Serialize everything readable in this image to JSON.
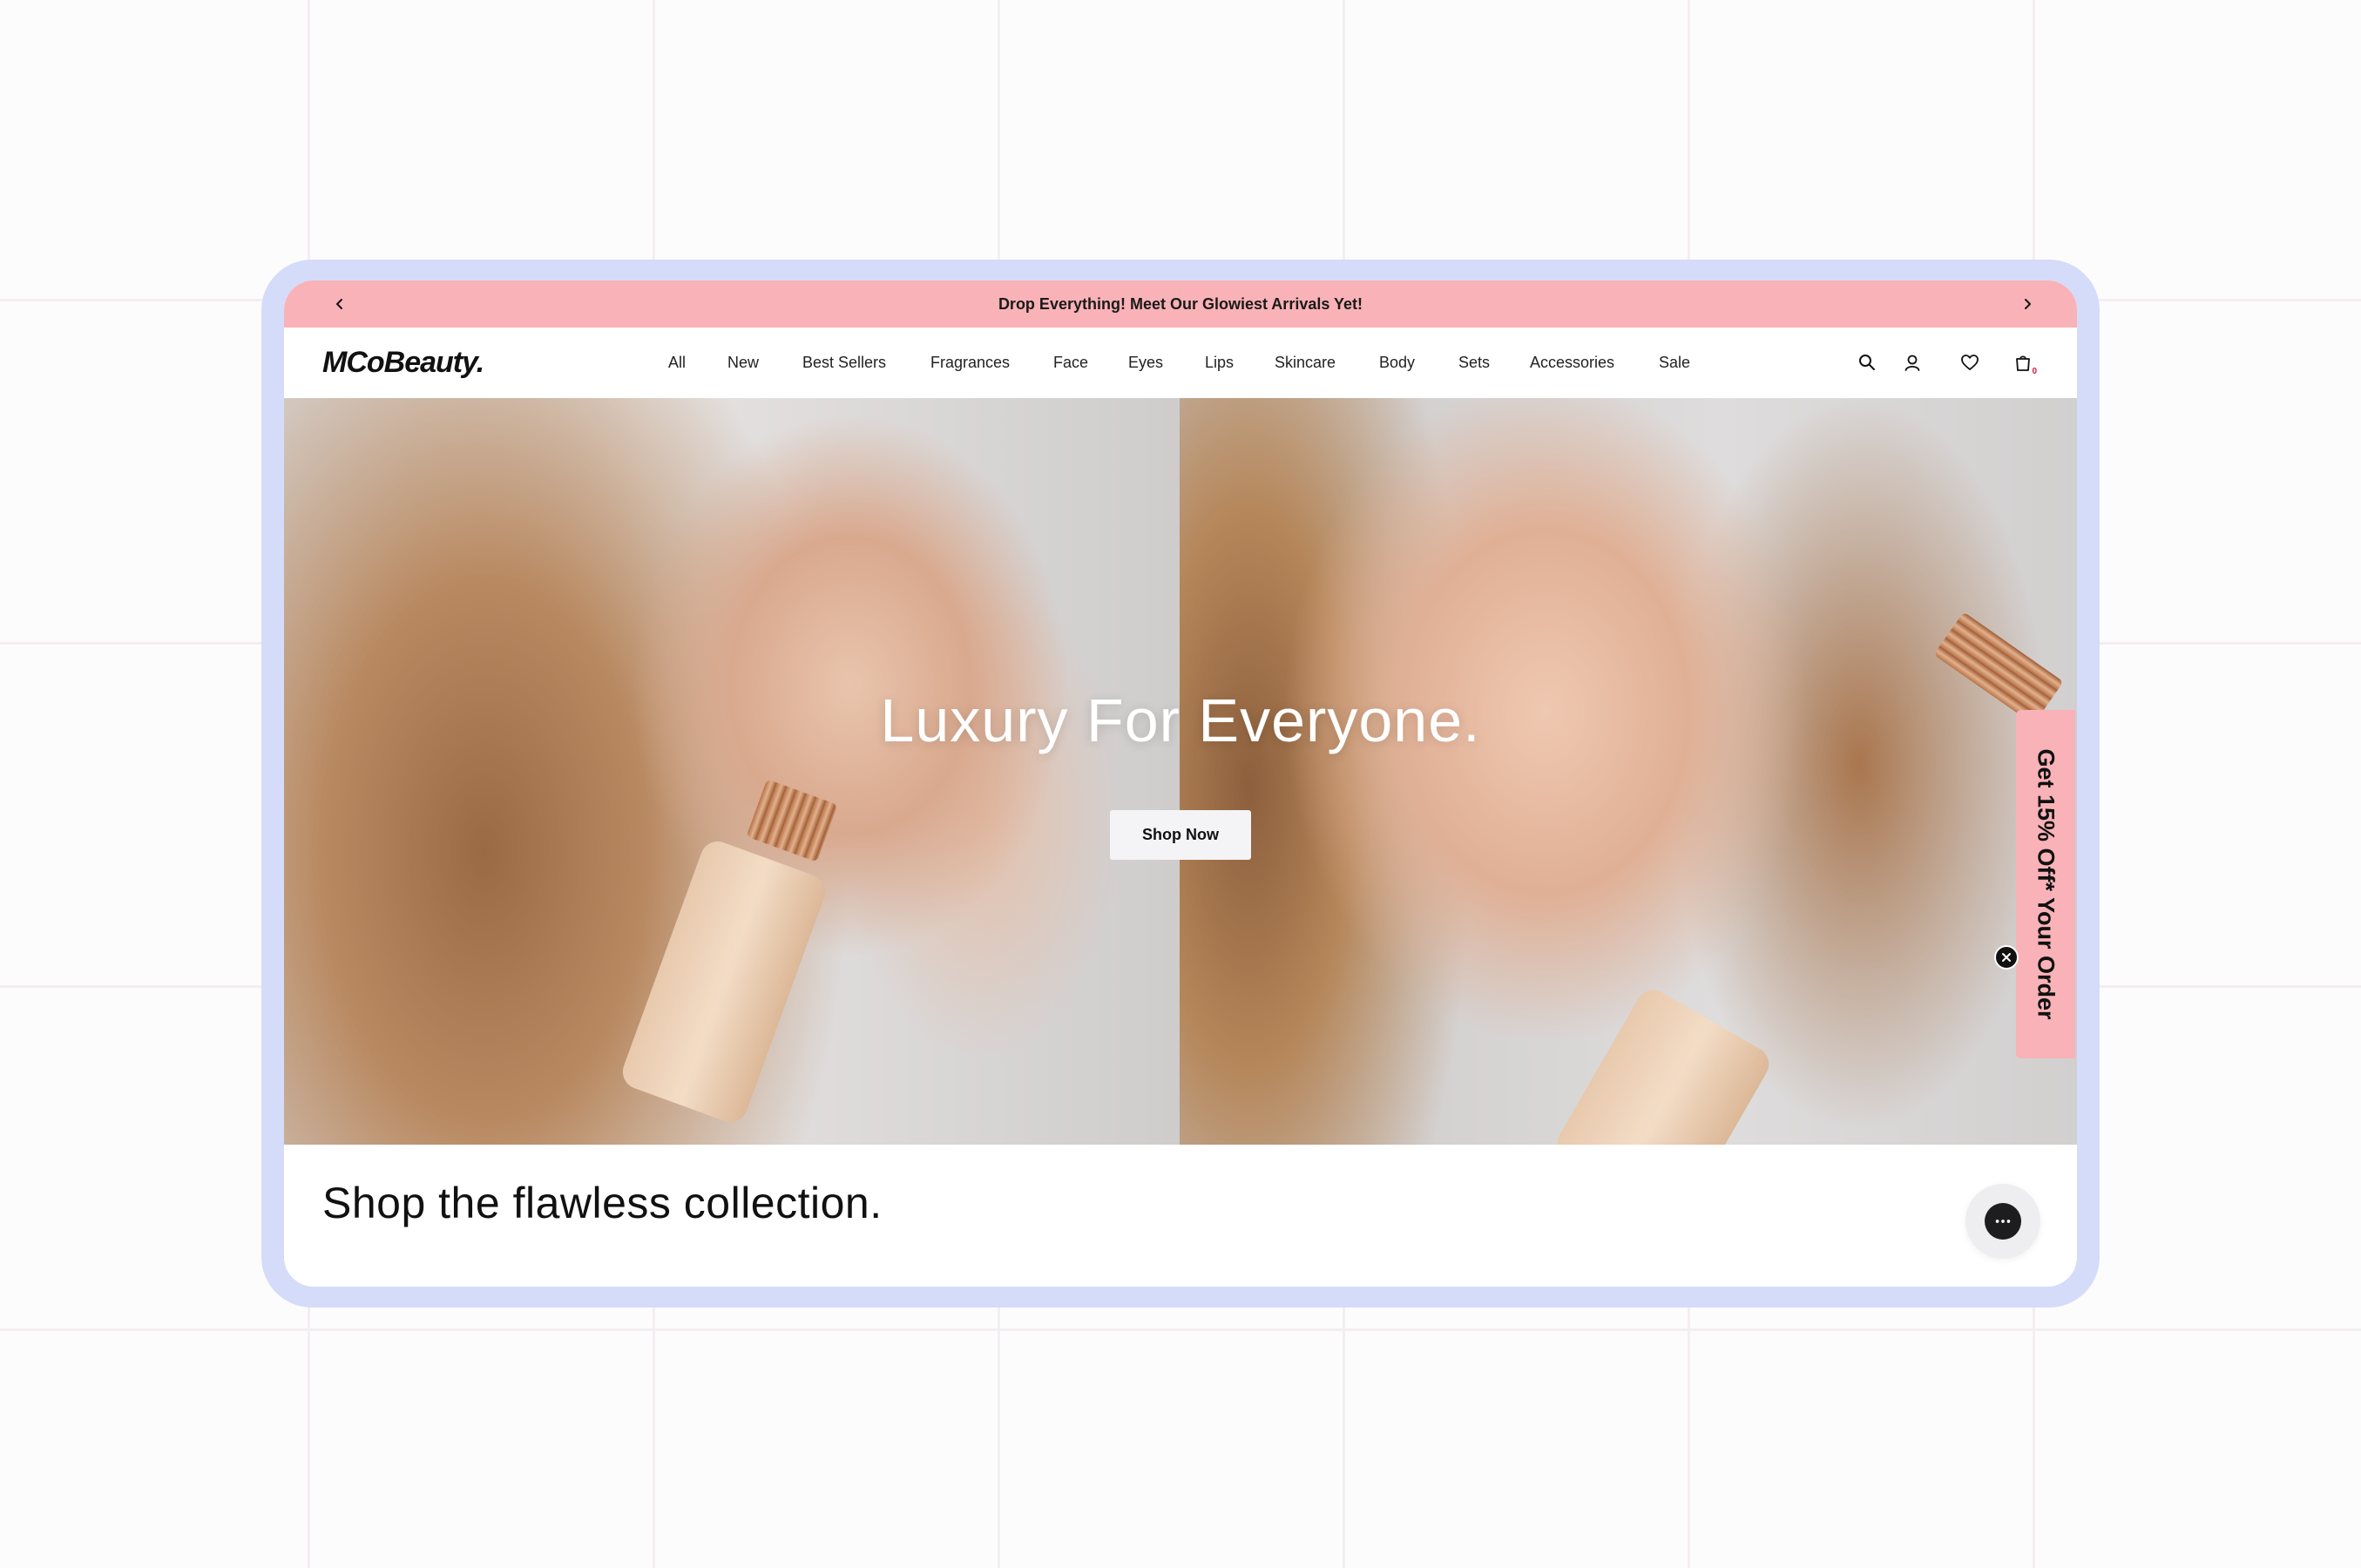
{
  "announcement": {
    "text": "Drop Everything! Meet Our Glowiest Arrivals Yet!",
    "prev_icon": "chevron-left-icon",
    "next_icon": "chevron-right-icon"
  },
  "header": {
    "logo": "MCoBeauty.",
    "nav": [
      "All",
      "New",
      "Best Sellers",
      "Fragrances",
      "Face",
      "Eyes",
      "Lips",
      "Skincare",
      "Body",
      "Sets",
      "Accessories",
      "Sale"
    ],
    "icons": [
      "search-icon",
      "account-icon",
      "wishlist-heart-icon",
      "cart-bag-icon"
    ],
    "cart_count": "0"
  },
  "hero": {
    "title": "Luxury For Everyone.",
    "button": "Shop Now"
  },
  "promo": {
    "tab_text": "Get 15% Off* Your Order",
    "close_icon": "close-icon"
  },
  "section": {
    "title": "Shop the flawless collection."
  },
  "chat": {
    "icon": "chat-icon"
  },
  "colors": {
    "announcement_bg": "#f9b2b7",
    "frame": "#d4dcfa",
    "button_bg": "#f4f4f6",
    "text": "#111111"
  }
}
